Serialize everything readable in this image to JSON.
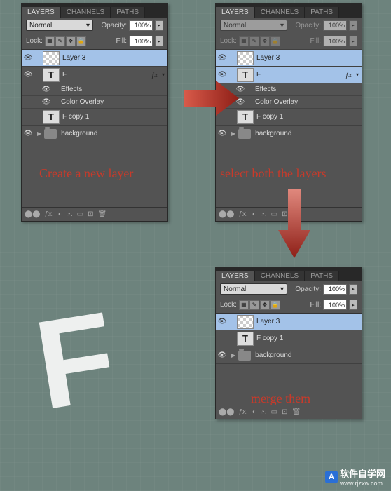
{
  "tabs": {
    "layers": "LAYERS",
    "channels": "CHANNELS",
    "paths": "PATHS"
  },
  "controls": {
    "blend": "Normal",
    "opacity_label": "Opacity:",
    "opacity_value": "100%",
    "lock_label": "Lock:",
    "fill_label": "Fill:",
    "fill_value": "100%"
  },
  "lock_icons": [
    "▦",
    "✎",
    "✥",
    "🔒"
  ],
  "panel1": {
    "layers": [
      {
        "name": "Layer 3"
      },
      {
        "name": "F"
      },
      {
        "name": "F copy 1"
      }
    ],
    "effects_label": "Effects",
    "color_overlay_label": "Color Overlay",
    "bg_label": "background"
  },
  "panel2": {
    "layers": [
      {
        "name": "Layer 3"
      },
      {
        "name": "F"
      },
      {
        "name": "F copy 1"
      }
    ],
    "effects_label": "Effects",
    "color_overlay_label": "Color Overlay",
    "bg_label": "background"
  },
  "panel3": {
    "layers": [
      {
        "name": "Layer 3"
      },
      {
        "name": "F copy 1"
      }
    ],
    "bg_label": "background"
  },
  "bottom_icons": [
    "⬤⬤",
    "ƒx.",
    "◐",
    "◔.",
    "▭",
    "⊡",
    "🗑"
  ],
  "annotations": {
    "create": "Create a new layer",
    "select": "select both the layers",
    "merge": "merge them"
  },
  "letter": "F",
  "watermark": {
    "text": "软件自学网",
    "url": "www.rjzxw.com"
  }
}
